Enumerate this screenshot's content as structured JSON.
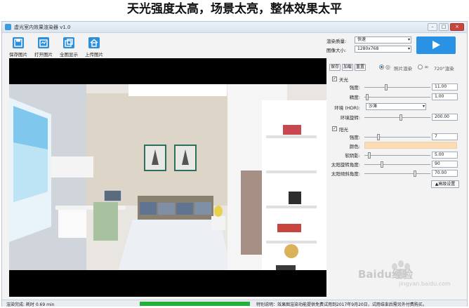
{
  "headline": "天光强度太高，场景太亮，整体效果太平",
  "window": {
    "title": "虚光室内效果渲染器 v1.0"
  },
  "toolbar": {
    "save_label": "保存图片",
    "open_label": "打开图片",
    "fullscreen_label": "全图显示",
    "upload_label": "上传图片"
  },
  "render": {
    "quality_label": "渲染质量:",
    "quality_value": "快速",
    "size_label": "图像大小:",
    "size_value": "1280x768"
  },
  "panel": {
    "save_btn": "保存",
    "load_btn": "加载",
    "reset_btn": "重置",
    "mode_photo": "照片渲染",
    "mode_720": "720°渲染",
    "skylight": {
      "enabled_label": "天光",
      "enabled": true,
      "strength_label": "强度:",
      "strength_value": "11.00",
      "strength_level": 0.32,
      "precision_label": "精度:",
      "precision_value": "1.00",
      "precision_level": 0.02,
      "env_label": "环境 (HDR):",
      "env_value": "沙滩",
      "env_rotation_label": "环境旋转:",
      "env_rotation_value": "200.00",
      "env_rotation_level": 0.55
    },
    "sun": {
      "enabled_label": "阳光",
      "enabled": true,
      "strength_label": "强度:",
      "strength_value": "7",
      "strength_level": 0.2,
      "color_label": "颜色:",
      "color": "#fbdcb4",
      "softness_label": "软阴影:",
      "softness_value": "5.00",
      "softness_level": 0.05,
      "rotate_label": "太阳旋转角度:",
      "rotate_value": "90",
      "rotate_level": 0.25,
      "tilt_label": "太阳倾斜角度:",
      "tilt_value": "70.00",
      "tilt_level": 0.78
    },
    "advanced_btn": "▲高级设置"
  },
  "status": {
    "left": "渲染完成: 耗时 0.69 min",
    "progress": 1.0,
    "right": "特别说明：效果图渲染功能提供免费试用到2017年9月20日，试用结束后需另外付费购买。"
  },
  "watermark": {
    "text": "Baidu经验",
    "sub": "jingyan.baidu.com"
  },
  "colors": {
    "accent": "#2a92e4",
    "progress": "#23b03a"
  }
}
